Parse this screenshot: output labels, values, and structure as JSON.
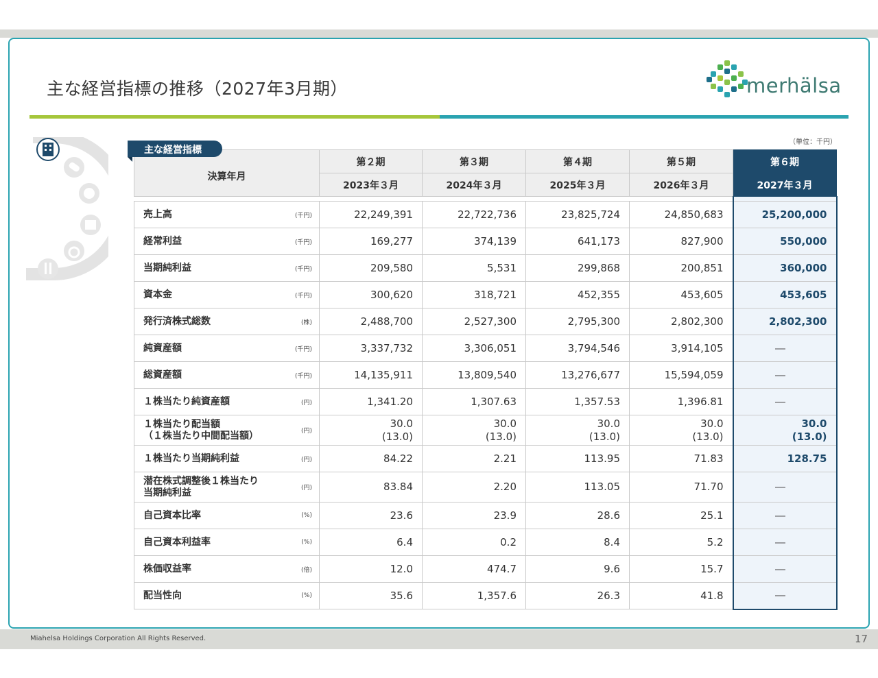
{
  "title": "主な経営指標の推移（2027年3月期）",
  "logo_text": "merhälsa",
  "unit_note": "（単位：千円）",
  "section_tag": "主な経営指標",
  "header": {
    "corner": "決算年月",
    "periods": [
      "第２期",
      "第３期",
      "第４期",
      "第５期",
      "第６期"
    ],
    "dates": [
      "2023年３月",
      "2024年３月",
      "2025年３月",
      "2026年３月",
      "2027年３月"
    ]
  },
  "rows": [
    {
      "label": "売上高",
      "label2": "",
      "unit": "(千円)",
      "values": [
        "22,249,391",
        "22,722,736",
        "23,825,724",
        "24,850,683"
      ],
      "values2": [
        "",
        "",
        "",
        ""
      ],
      "forecast": "25,200,000",
      "forecast2": ""
    },
    {
      "label": "経常利益",
      "label2": "",
      "unit": "(千円)",
      "values": [
        "169,277",
        "374,139",
        "641,173",
        "827,900"
      ],
      "values2": [
        "",
        "",
        "",
        ""
      ],
      "forecast": "550,000",
      "forecast2": ""
    },
    {
      "label": "当期純利益",
      "label2": "",
      "unit": "(千円)",
      "values": [
        "209,580",
        "5,531",
        "299,868",
        "200,851"
      ],
      "values2": [
        "",
        "",
        "",
        ""
      ],
      "forecast": "360,000",
      "forecast2": ""
    },
    {
      "label": "資本金",
      "label2": "",
      "unit": "(千円)",
      "values": [
        "300,620",
        "318,721",
        "452,355",
        "453,605"
      ],
      "values2": [
        "",
        "",
        "",
        ""
      ],
      "forecast": "453,605",
      "forecast2": ""
    },
    {
      "label": "発行済株式総数",
      "label2": "",
      "unit": "(株)",
      "values": [
        "2,488,700",
        "2,527,300",
        "2,795,300",
        "2,802,300"
      ],
      "values2": [
        "",
        "",
        "",
        ""
      ],
      "forecast": "2,802,300",
      "forecast2": ""
    },
    {
      "label": "純資産額",
      "label2": "",
      "unit": "(千円)",
      "values": [
        "3,337,732",
        "3,306,051",
        "3,794,546",
        "3,914,105"
      ],
      "values2": [
        "",
        "",
        "",
        ""
      ],
      "forecast": "―",
      "forecast2": ""
    },
    {
      "label": "総資産額",
      "label2": "",
      "unit": "(千円)",
      "values": [
        "14,135,911",
        "13,809,540",
        "13,276,677",
        "15,594,059"
      ],
      "values2": [
        "",
        "",
        "",
        ""
      ],
      "forecast": "―",
      "forecast2": ""
    },
    {
      "label": "１株当たり純資産額",
      "label2": "",
      "unit": "(円)",
      "values": [
        "1,341.20",
        "1,307.63",
        "1,357.53",
        "1,396.81"
      ],
      "values2": [
        "",
        "",
        "",
        ""
      ],
      "forecast": "―",
      "forecast2": ""
    },
    {
      "label": "１株当たり配当額",
      "label2": "（１株当たり中間配当額）",
      "unit": "(円)",
      "values": [
        "30.0",
        "30.0",
        "30.0",
        "30.0"
      ],
      "values2": [
        "(13.0)",
        "(13.0)",
        "(13.0)",
        "(13.0)"
      ],
      "forecast": "30.0",
      "forecast2": "(13.0)"
    },
    {
      "label": "１株当たり当期純利益",
      "label2": "",
      "unit": "(円)",
      "values": [
        "84.22",
        "2.21",
        "113.95",
        "71.83"
      ],
      "values2": [
        "",
        "",
        "",
        ""
      ],
      "forecast": "128.75",
      "forecast2": ""
    },
    {
      "label": "潜在株式調整後１株当たり",
      "label2": "当期純利益",
      "unit": "(円)",
      "values": [
        "83.84",
        "2.20",
        "113.05",
        "71.70"
      ],
      "values2": [
        "",
        "",
        "",
        ""
      ],
      "forecast": "―",
      "forecast2": ""
    },
    {
      "label": "自己資本比率",
      "label2": "",
      "unit": "(%)",
      "values": [
        "23.6",
        "23.9",
        "28.6",
        "25.1"
      ],
      "values2": [
        "",
        "",
        "",
        ""
      ],
      "forecast": "―",
      "forecast2": ""
    },
    {
      "label": "自己資本利益率",
      "label2": "",
      "unit": "(%)",
      "values": [
        "6.4",
        "0.2",
        "8.4",
        "5.2"
      ],
      "values2": [
        "",
        "",
        "",
        ""
      ],
      "forecast": "―",
      "forecast2": ""
    },
    {
      "label": "株価収益率",
      "label2": "",
      "unit": "(倍)",
      "values": [
        "12.0",
        "474.7",
        "9.6",
        "15.7"
      ],
      "values2": [
        "",
        "",
        "",
        ""
      ],
      "forecast": "―",
      "forecast2": ""
    },
    {
      "label": "配当性向",
      "label2": "",
      "unit": "(%)",
      "values": [
        "35.6",
        "1,357.6",
        "26.3",
        "41.8"
      ],
      "values2": [
        "",
        "",
        "",
        ""
      ],
      "forecast": "―",
      "forecast2": ""
    }
  ],
  "footer": "Miahelsa Holdings Corporation All Rights Reserved.",
  "page_number": "17",
  "colors": {
    "teal": "#2aa3b0",
    "green": "#a5c63b",
    "navy": "#1e4a6b",
    "highlight_bg": "#eef4fa"
  }
}
